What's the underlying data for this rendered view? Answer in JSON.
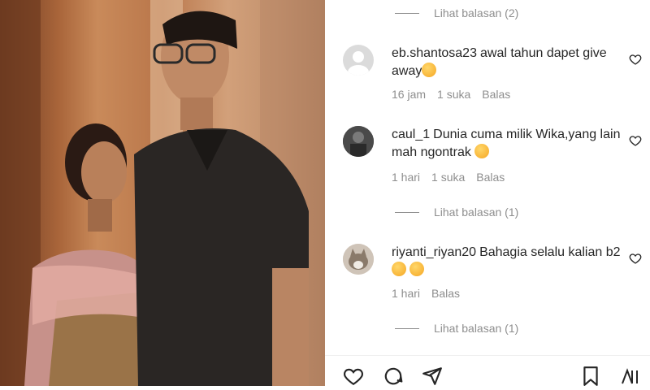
{
  "replies_top": {
    "label": "Lihat balasan (2)"
  },
  "comments": [
    {
      "username": "eb.shantosa23",
      "text": "awal tahun dapet give away",
      "emoji": "tongue-out-emoji",
      "time": "16 jam",
      "likes": "1 suka",
      "reply": "Balas"
    },
    {
      "username": "caul_1",
      "text": "Dunia cuma milik Wika,yang lain mah ngontrak",
      "emoji": "surprised-emoji",
      "time": "1 hari",
      "likes": "1 suka",
      "reply": "Balas",
      "replies": "Lihat balasan (1)"
    },
    {
      "username": "riyanti_riyan20",
      "text": "Bahagia selalu kalian b2",
      "emoji": "heart-eyes-emoji",
      "time": "1 hari",
      "reply": "Balas",
      "replies": "Lihat balasan (1)"
    }
  ],
  "icons": [
    "heart-icon",
    "comment-icon",
    "share-icon",
    "bookmark-icon"
  ],
  "colors": {
    "muted": "#8e8e8e",
    "text": "#262626"
  }
}
